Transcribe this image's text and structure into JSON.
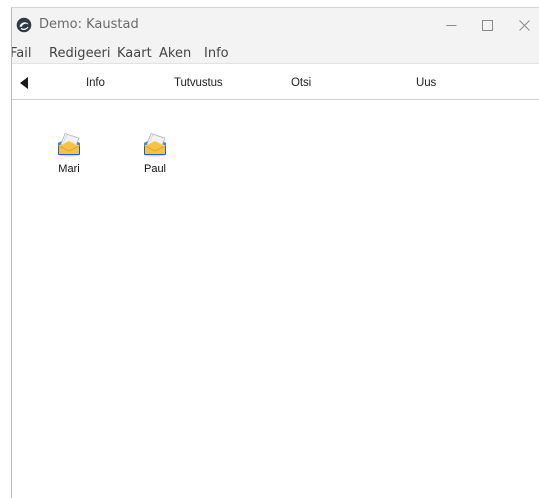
{
  "window": {
    "title": "Demo: Kaustad"
  },
  "menubar": {
    "items": [
      "Fail",
      "Redigeeri",
      "Kaart",
      "Aken",
      "Info"
    ]
  },
  "toolbar": {
    "items": [
      "Info",
      "Tutvustus",
      "Otsi",
      "Uus"
    ]
  },
  "folders": [
    {
      "label": "Mari",
      "icon": "mail-folder-icon"
    },
    {
      "label": "Paul",
      "icon": "mail-folder-icon"
    }
  ]
}
